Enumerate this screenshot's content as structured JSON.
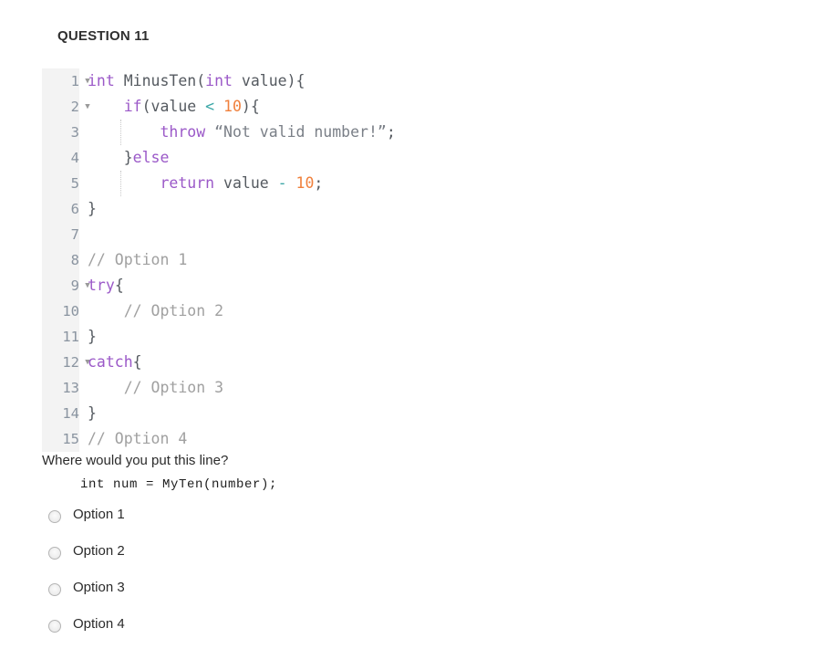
{
  "question": {
    "header": "QUESTION 11"
  },
  "code": {
    "lines": [
      {
        "number": "1",
        "foldable": true,
        "fold_icon": "chevron-down-icon",
        "tokens": [
          {
            "t": "int",
            "c": "kw"
          },
          {
            "t": " MinusTen(",
            "c": "pln"
          },
          {
            "t": "int",
            "c": "kw"
          },
          {
            "t": " value){",
            "c": "pln"
          }
        ]
      },
      {
        "number": "2",
        "foldable": true,
        "fold_icon": "chevron-down-icon",
        "tokens": [
          {
            "t": "    ",
            "c": "pln"
          },
          {
            "t": "if",
            "c": "kw"
          },
          {
            "t": "(value ",
            "c": "pln"
          },
          {
            "t": "<",
            "c": "op"
          },
          {
            "t": " ",
            "c": "pln"
          },
          {
            "t": "10",
            "c": "num"
          },
          {
            "t": "){",
            "c": "pln"
          }
        ]
      },
      {
        "number": "3",
        "foldable": false,
        "fold_icon": "",
        "tokens": [
          {
            "t": "        ",
            "c": "pln"
          },
          {
            "t": "throw",
            "c": "kw"
          },
          {
            "t": " ",
            "c": "pln"
          },
          {
            "t": "“Not valid number!”",
            "c": "str"
          },
          {
            "t": ";",
            "c": "pln"
          }
        ]
      },
      {
        "number": "4",
        "foldable": false,
        "fold_icon": "",
        "tokens": [
          {
            "t": "    }",
            "c": "pln"
          },
          {
            "t": "else",
            "c": "kw"
          }
        ]
      },
      {
        "number": "5",
        "foldable": false,
        "fold_icon": "",
        "tokens": [
          {
            "t": "        ",
            "c": "pln"
          },
          {
            "t": "return",
            "c": "kw"
          },
          {
            "t": " value ",
            "c": "pln"
          },
          {
            "t": "-",
            "c": "op"
          },
          {
            "t": " ",
            "c": "pln"
          },
          {
            "t": "10",
            "c": "num"
          },
          {
            "t": ";",
            "c": "pln"
          }
        ]
      },
      {
        "number": "6",
        "foldable": false,
        "fold_icon": "",
        "tokens": [
          {
            "t": "}",
            "c": "pln"
          }
        ]
      },
      {
        "number": "7",
        "foldable": false,
        "fold_icon": "",
        "tokens": []
      },
      {
        "number": "8",
        "foldable": false,
        "fold_icon": "",
        "tokens": [
          {
            "t": "// Option 1",
            "c": "cmt"
          }
        ]
      },
      {
        "number": "9",
        "foldable": true,
        "fold_icon": "chevron-down-icon",
        "tokens": [
          {
            "t": "try",
            "c": "kw"
          },
          {
            "t": "{",
            "c": "pln"
          }
        ]
      },
      {
        "number": "10",
        "foldable": false,
        "fold_icon": "",
        "tokens": [
          {
            "t": "    ",
            "c": "pln"
          },
          {
            "t": "// Option 2",
            "c": "cmt"
          }
        ]
      },
      {
        "number": "11",
        "foldable": false,
        "fold_icon": "",
        "tokens": [
          {
            "t": "}",
            "c": "pln"
          }
        ]
      },
      {
        "number": "12",
        "foldable": true,
        "fold_icon": "chevron-down-icon",
        "tokens": [
          {
            "t": "catch",
            "c": "kw"
          },
          {
            "t": "{",
            "c": "pln"
          }
        ]
      },
      {
        "number": "13",
        "foldable": false,
        "fold_icon": "",
        "tokens": [
          {
            "t": "    ",
            "c": "pln"
          },
          {
            "t": "// Option 3",
            "c": "cmt"
          }
        ]
      },
      {
        "number": "14",
        "foldable": false,
        "fold_icon": "",
        "tokens": [
          {
            "t": "}",
            "c": "pln"
          }
        ]
      },
      {
        "number": "15",
        "foldable": false,
        "fold_icon": "",
        "tokens": [
          {
            "t": "// Option 4",
            "c": "cmt"
          }
        ]
      }
    ],
    "colors": {
      "keyword": "#9b59c8",
      "number": "#f0803c",
      "operator": "#3aa6a6",
      "string": "#7a7f87",
      "comment": "#a0a0a0",
      "plain": "#555a60",
      "gutter_background": "#f3f3f3",
      "gutter_text": "#8a94a0"
    }
  },
  "prompt": {
    "text": "Where would you put this line?",
    "snippet": "int num = MyTen(number);"
  },
  "answers": {
    "options": [
      {
        "label": "Option 1",
        "selected": false
      },
      {
        "label": "Option 2",
        "selected": false
      },
      {
        "label": "Option 3",
        "selected": false
      },
      {
        "label": "Option 4",
        "selected": false
      }
    ]
  }
}
